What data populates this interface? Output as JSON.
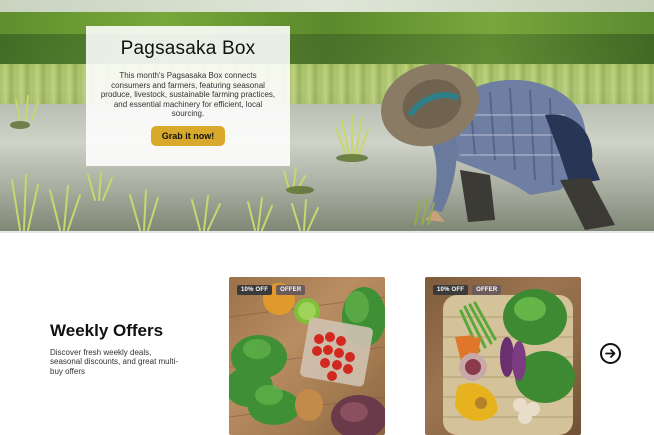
{
  "hero": {
    "title": "Pagsasaka Box",
    "description": "This month's Pagsasaka Box connects consumers and farmers, featuring seasonal produce, livestock, sustainable farming practices, and essential machinery for efficient, local sourcing.",
    "cta_label": "Grab it now!"
  },
  "offers": {
    "title": "Weekly Offers",
    "description": "Discover fresh weekly deals, seasonal discounts, and great multi-buy offers",
    "cards": [
      {
        "discount_tag": "10% OFF",
        "offer_tag": "OFFER"
      },
      {
        "discount_tag": "10% OFF",
        "offer_tag": "OFFER"
      }
    ],
    "next_icon": "arrow-right-circle-icon"
  },
  "colors": {
    "cta_background": "#d8a92a",
    "discount_tag": "#3a3a3a",
    "offer_tag": "#6d5a5a"
  }
}
